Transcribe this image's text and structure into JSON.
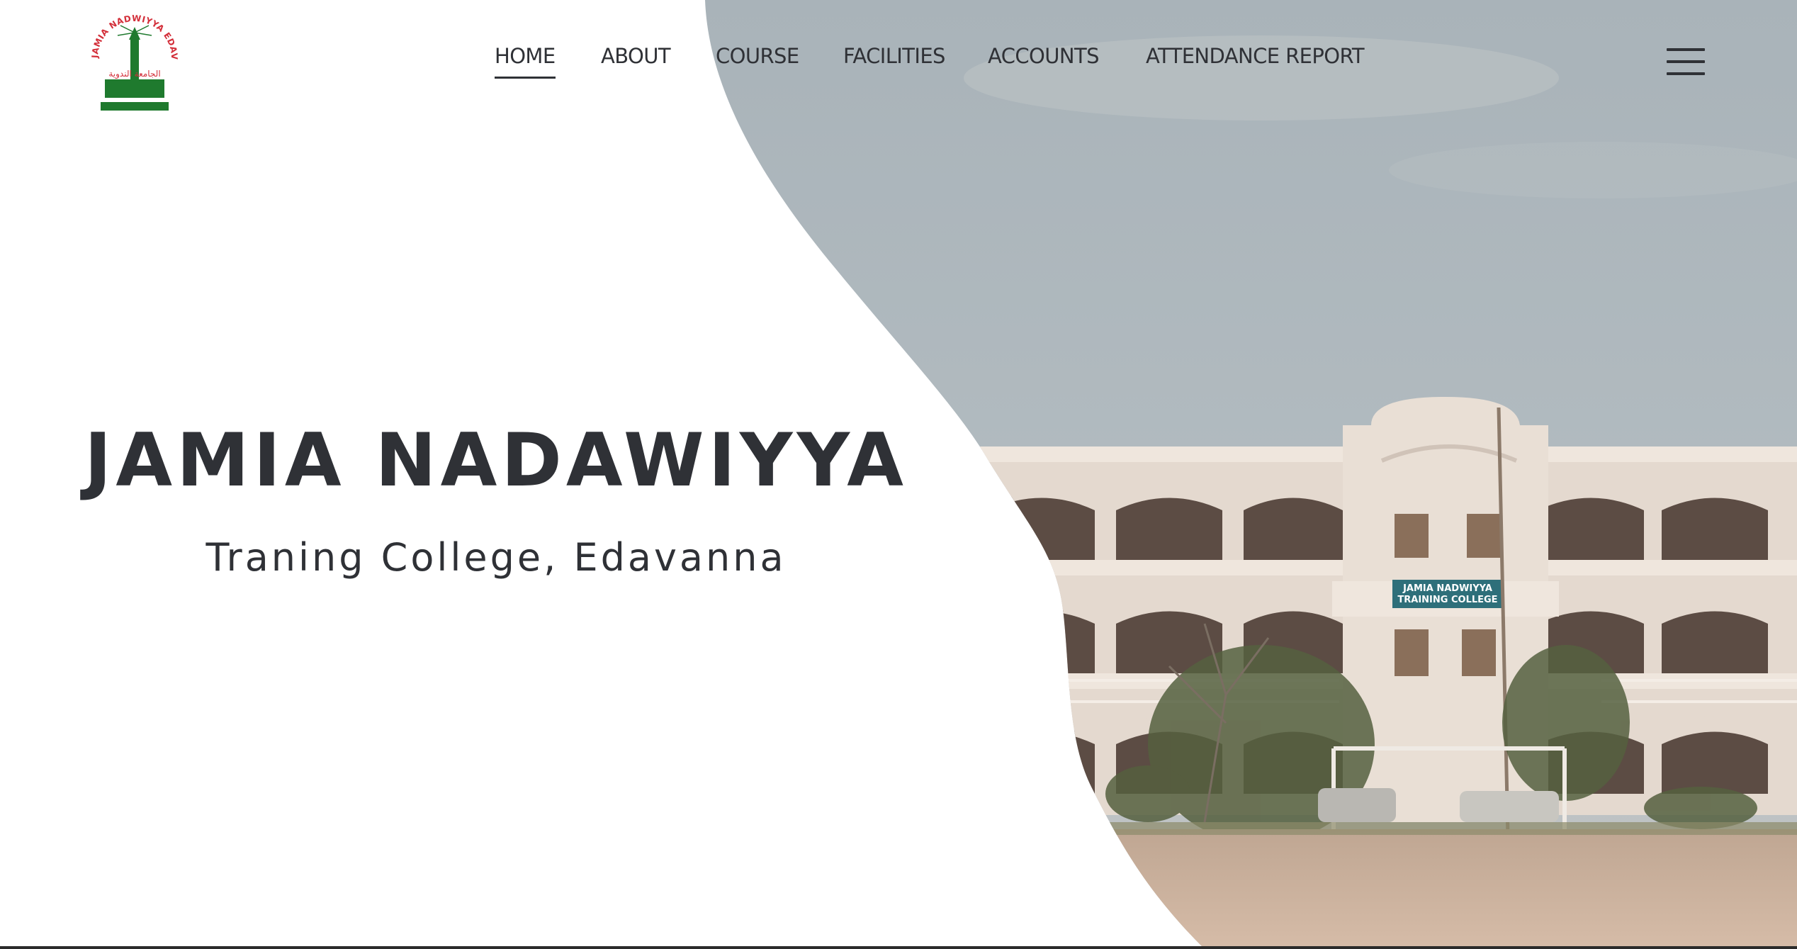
{
  "logo": {
    "ring_text": "JAMIA NADWIYYA EDAVANNA",
    "arabic_text": "الجامعة الندوية",
    "icon": "minaret-emblem-icon"
  },
  "nav": {
    "items": [
      {
        "label": "HOME",
        "active": true
      },
      {
        "label": "ABOUT",
        "active": false
      },
      {
        "label": "COURSE",
        "active": false
      },
      {
        "label": "FACILITIES",
        "active": false
      },
      {
        "label": "ACCOUNTS",
        "active": false
      },
      {
        "label": "ATTENDANCE REPORT",
        "active": false
      }
    ],
    "menu_icon": "hamburger-menu-icon"
  },
  "hero": {
    "title": "JAMIA NADAWIYYA",
    "subtitle": "Traning College, Edavanna",
    "sign_line1": "JAMIA NADWIYYA",
    "sign_line2": "TRAINING COLLEGE"
  },
  "colors": {
    "text": "#2f3136",
    "logo_green": "#1f7a2e",
    "logo_red": "#d32f3a",
    "sky": "#aab4ba",
    "building": "#e6dcd2",
    "ground": "#cdb09c"
  }
}
